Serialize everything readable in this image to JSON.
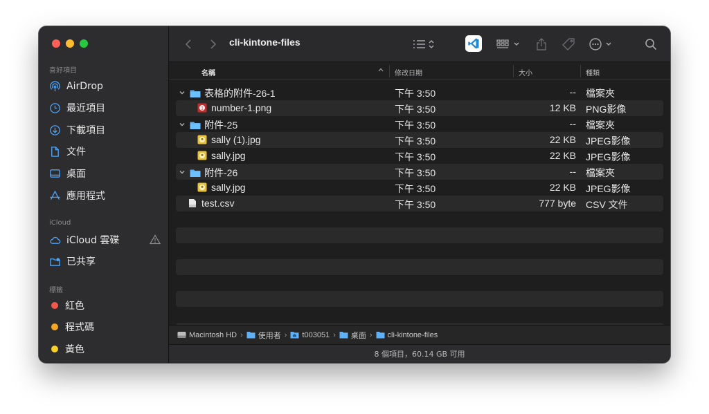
{
  "toolbar": {
    "title": "cli-kintone-files",
    "back_icon": "chevron-left-icon",
    "forward_icon": "chevron-right-icon"
  },
  "sidebar": {
    "section_favorites": "喜好項目",
    "favorites": [
      {
        "label": "AirDrop",
        "icon": "airdrop-icon"
      },
      {
        "label": "最近項目",
        "icon": "clock-icon"
      },
      {
        "label": "下載項目",
        "icon": "download-icon"
      },
      {
        "label": "文件",
        "icon": "document-icon"
      },
      {
        "label": "桌面",
        "icon": "desktop-icon"
      },
      {
        "label": "應用程式",
        "icon": "apps-icon"
      }
    ],
    "section_icloud": "iCloud",
    "icloud": [
      {
        "label": "iCloud 雲碟",
        "icon": "cloud-icon"
      },
      {
        "label": "已共享",
        "icon": "shared-folder-icon"
      }
    ],
    "section_tags": "標籤",
    "tags": [
      {
        "label": "紅色",
        "color": "#f3574c"
      },
      {
        "label": "程式碼",
        "color": "#f5a623"
      },
      {
        "label": "黃色",
        "color": "#f8d128"
      }
    ]
  },
  "columns": {
    "name": "名稱",
    "date": "修改日期",
    "size": "大小",
    "kind": "種類"
  },
  "rows": [
    {
      "name": "表格的附件-26-1",
      "date": "下午 3:50",
      "size": "--",
      "kind": "檔案夾",
      "type": "folder",
      "level": 0,
      "expanded": true
    },
    {
      "name": "number-1.png",
      "date": "下午 3:50",
      "size": "12 KB",
      "kind": "PNG影像",
      "type": "png",
      "level": 1
    },
    {
      "name": "附件-25",
      "date": "下午 3:50",
      "size": "--",
      "kind": "檔案夾",
      "type": "folder",
      "level": 0,
      "expanded": true
    },
    {
      "name": "sally (1).jpg",
      "date": "下午 3:50",
      "size": "22 KB",
      "kind": "JPEG影像",
      "type": "jpg",
      "level": 1
    },
    {
      "name": "sally.jpg",
      "date": "下午 3:50",
      "size": "22 KB",
      "kind": "JPEG影像",
      "type": "jpg",
      "level": 1
    },
    {
      "name": "附件-26",
      "date": "下午 3:50",
      "size": "--",
      "kind": "檔案夾",
      "type": "folder",
      "level": 0,
      "expanded": true
    },
    {
      "name": "sally.jpg",
      "date": "下午 3:50",
      "size": "22 KB",
      "kind": "JPEG影像",
      "type": "jpg",
      "level": 1
    },
    {
      "name": "test.csv",
      "date": "下午 3:50",
      "size": "777 byte",
      "kind": "CSV 文件",
      "type": "csv",
      "level": 0
    }
  ],
  "pathbar": [
    {
      "label": "Macintosh HD",
      "icon": "hard-drive-icon"
    },
    {
      "label": "使用者",
      "icon": "folder-icon"
    },
    {
      "label": "t003051",
      "icon": "home-folder-icon"
    },
    {
      "label": "桌面",
      "icon": "folder-icon"
    },
    {
      "label": "cli-kintone-files",
      "icon": "folder-icon"
    }
  ],
  "status": "8 個項目，60.14 GB 可用",
  "colors": {
    "accent": "#4fa3f7",
    "folder": "#5fb0f5"
  }
}
